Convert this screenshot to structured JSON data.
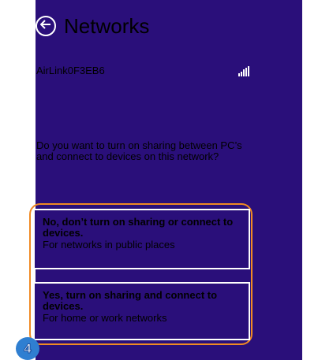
{
  "screen": {
    "title": "Networks",
    "network_name": "AirLink0F3EB6",
    "question": "Do you want to turn on sharing between PC’s and connect to devices on this network?",
    "options": [
      {
        "title": "No, don’t turn on sharing or connect to devices.",
        "subtitle": "For networks in public places"
      },
      {
        "title": "Yes, turn on sharing and connect to devices.",
        "subtitle": "For home or work networks"
      }
    ],
    "step_number": "4"
  },
  "icons": {
    "back": "back-arrow-icon",
    "signal": "wifi-signal-icon"
  },
  "colors": {
    "background": "#2a0f7a",
    "highlight": "#f08a24",
    "badge": "#2f7fd1"
  }
}
